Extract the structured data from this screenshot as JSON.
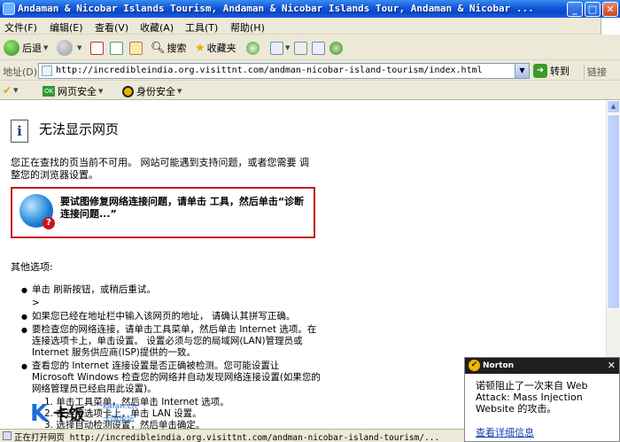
{
  "window": {
    "title": "Andaman & Nicobar Islands Tourism, Andaman & Nicobar Islands Tour, Andaman & Nicobar ...",
    "min": "_",
    "max": "□",
    "close": "✕"
  },
  "menu": [
    "文件(F)",
    "编辑(E)",
    "查看(V)",
    "收藏(A)",
    "工具(T)",
    "帮助(H)"
  ],
  "toolbar": {
    "back": "后退",
    "search": "搜索",
    "favorites": "收藏夹"
  },
  "address": {
    "label": "地址(D)",
    "url": "http://incredibleindia.org.visittnt.com/andman-nicobar-island-tourism/index.html",
    "goto": "转到",
    "links": "链接"
  },
  "linksbar": {
    "web_security": "网页安全",
    "identity_security": "身份安全"
  },
  "page": {
    "title": "无法显示网页",
    "intro": "您正在查找的页当前不可用。 网站可能遇到支持问题，或者您需要 调整您的浏览器设置。",
    "diag": "要试图修复网络连接问题，请单击 工具，然后单击“诊断连接问题...”",
    "other_label": "其他选项:",
    "options": [
      "单击 刷新按钮，或稍后重试。",
      ">",
      "如果您已经在地址栏中输入该网页的地址， 请确认其拼写正确。",
      "要检查您的网络连接，请单击工具菜单，然后单击 Internet 选项。在连接选项卡上，单击设置。 设置必须与您的局域网(LAN)管理员或 Internet 服务供应商(ISP)提供的一致。",
      "查看您的 Internet 连接设置是否正确被检测。您可能设置让 Microsoft Windows 检查您的网络并自动发现网络连接设置(如果您的网络管理员已经启用此设置)。"
    ],
    "substeps": [
      "1. 单击工具菜单，然后单击 Internet 选项。",
      "2. 在连接选项卡上，单击 LAN 设置。",
      "3. 选择自动检测设置，然后单击确定。"
    ]
  },
  "norton": {
    "brand": "Norton",
    "message": "诺顿阻止了一次来自 Web Attack: Mass Injection Website 的攻击。",
    "link": "查看详细信息",
    "close": "✕"
  },
  "status": {
    "text": "正在打开网页 http://incredibleindia.org.visittnt.com/andman-nicobar-island-tourism/..."
  },
  "watermark": {
    "k": "K",
    "name": "卡饭",
    "sub1": "kafan.cn",
    "sub2": "卡饭论坛"
  }
}
